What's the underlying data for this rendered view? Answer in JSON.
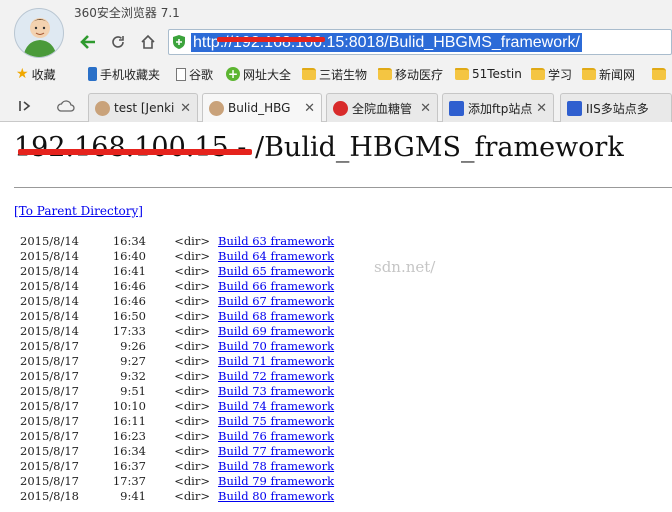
{
  "app": {
    "title": "360安全浏览器 7.1"
  },
  "address": {
    "url": "http://192.168.100.15:8018/Bulid_HBGMS_framework/"
  },
  "bookmarks": [
    {
      "label": "收藏",
      "icon": "star-icon"
    },
    {
      "label": "手机收藏夹",
      "icon": "phone-icon"
    },
    {
      "label": "谷歌",
      "icon": "doc-icon"
    },
    {
      "label": "网址大全",
      "icon": "plus-icon"
    },
    {
      "label": "三诺生物",
      "icon": "folder-icon"
    },
    {
      "label": "移动医疗",
      "icon": "folder-icon"
    },
    {
      "label": "51Testin",
      "icon": "folder-icon"
    },
    {
      "label": "学习",
      "icon": "folder-icon"
    },
    {
      "label": "新闻网",
      "icon": "folder-icon"
    }
  ],
  "tabs": [
    {
      "label": "test [Jenki",
      "icon": "jenkins-icon"
    },
    {
      "label": "Bulid_HBG",
      "icon": "jenkins-icon"
    },
    {
      "label": "全院血糖管",
      "icon": "hospital-icon"
    },
    {
      "label": "添加ftp站点",
      "icon": "paw-icon"
    },
    {
      "label": "IIS多站点多",
      "icon": "paw-icon"
    }
  ],
  "page": {
    "heading": "192.168.100.15 - /Bulid_HBGMS_framework",
    "parent_link": "[To Parent Directory]",
    "watermark": "sdn.net/",
    "entries": [
      {
        "date": "2015/8/14",
        "time": "16:34",
        "kind": "<dir>",
        "name": "Build 63 framework"
      },
      {
        "date": "2015/8/14",
        "time": "16:40",
        "kind": "<dir>",
        "name": "Build 64 framework"
      },
      {
        "date": "2015/8/14",
        "time": "16:41",
        "kind": "<dir>",
        "name": "Build 65 framework"
      },
      {
        "date": "2015/8/14",
        "time": "16:46",
        "kind": "<dir>",
        "name": "Build 66 framework"
      },
      {
        "date": "2015/8/14",
        "time": "16:46",
        "kind": "<dir>",
        "name": "Build 67 framework"
      },
      {
        "date": "2015/8/14",
        "time": "16:50",
        "kind": "<dir>",
        "name": "Build 68 framework"
      },
      {
        "date": "2015/8/14",
        "time": "17:33",
        "kind": "<dir>",
        "name": "Build 69 framework"
      },
      {
        "date": "2015/8/17",
        "time": "9:26",
        "kind": "<dir>",
        "name": "Build 70 framework"
      },
      {
        "date": "2015/8/17",
        "time": "9:27",
        "kind": "<dir>",
        "name": "Build 71 framework"
      },
      {
        "date": "2015/8/17",
        "time": "9:32",
        "kind": "<dir>",
        "name": "Build 72 framework"
      },
      {
        "date": "2015/8/17",
        "time": "9:51",
        "kind": "<dir>",
        "name": "Build 73 framework"
      },
      {
        "date": "2015/8/17",
        "time": "10:10",
        "kind": "<dir>",
        "name": "Build 74 framework"
      },
      {
        "date": "2015/8/17",
        "time": "16:11",
        "kind": "<dir>",
        "name": "Build 75 framework"
      },
      {
        "date": "2015/8/17",
        "time": "16:23",
        "kind": "<dir>",
        "name": "Build 76 framework"
      },
      {
        "date": "2015/8/17",
        "time": "16:34",
        "kind": "<dir>",
        "name": "Build 77 framework"
      },
      {
        "date": "2015/8/17",
        "time": "16:37",
        "kind": "<dir>",
        "name": "Build 78 framework"
      },
      {
        "date": "2015/8/17",
        "time": "17:37",
        "kind": "<dir>",
        "name": "Build 79 framework"
      },
      {
        "date": "2015/8/18",
        "time": "9:41",
        "kind": "<dir>",
        "name": "Build 80 framework"
      }
    ]
  },
  "colors": {
    "link": "#0000ee",
    "selection": "#2c6bd7",
    "redaction": "#e5231d"
  }
}
